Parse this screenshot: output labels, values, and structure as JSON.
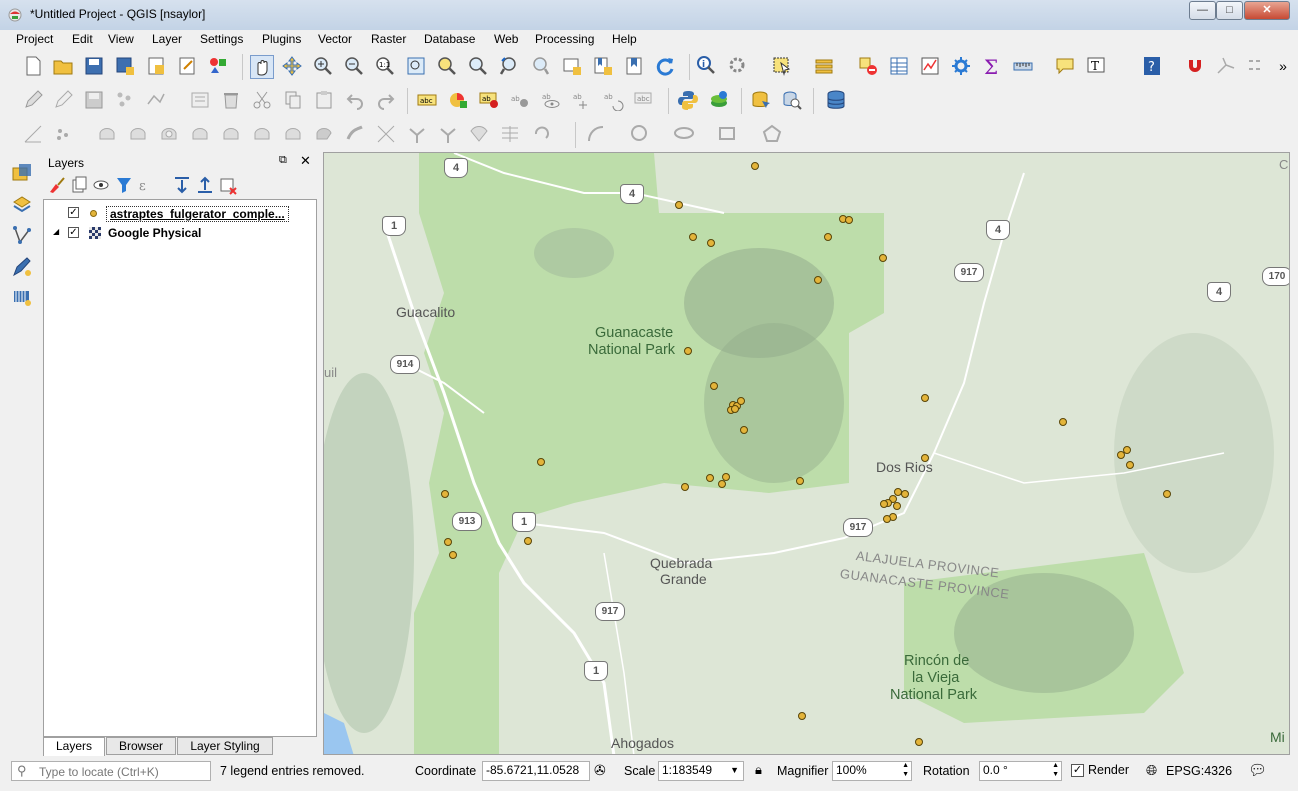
{
  "window": {
    "title": "*Untitled Project - QGIS [nsaylor]",
    "minimize": "—",
    "maximize": "□",
    "close": "✕"
  },
  "menu": [
    "Project",
    "Edit",
    "View",
    "Layer",
    "Settings",
    "Plugins",
    "Vector",
    "Raster",
    "Database",
    "Web",
    "Processing",
    "Help"
  ],
  "layers_panel": {
    "title": "Layers",
    "layers": [
      {
        "name": "astraptes_fulgerator_comple...",
        "checked": true,
        "icon": "point-layer-icon"
      },
      {
        "name": "Google Physical",
        "checked": true,
        "icon": "raster-layer-icon"
      }
    ],
    "tabs": [
      "Layers",
      "Browser",
      "Layer Styling"
    ],
    "active_tab": "Layers"
  },
  "map": {
    "places": [
      {
        "text": "Guacalito"
      },
      {
        "text": "Guanacaste"
      },
      {
        "text": "National Park"
      },
      {
        "text": "Dos Rios"
      },
      {
        "text": "Quebrada"
      },
      {
        "text": "Grande"
      },
      {
        "text": "ALAJUELA PROVINCE"
      },
      {
        "text": "GUANACASTE PROVINCE"
      },
      {
        "text": "Rincón de"
      },
      {
        "text": "la Vieja"
      },
      {
        "text": "National Park"
      },
      {
        "text": "Ahogados"
      },
      {
        "text": "Mi"
      },
      {
        "text": "C"
      },
      {
        "text": "uil"
      }
    ],
    "roads": [
      "4",
      "4",
      "1",
      "4",
      "917",
      "170",
      "4",
      "914",
      "913",
      "1",
      "917",
      "917",
      "1"
    ],
    "colors": {
      "park": "#b5d9a0",
      "land": "#dde6d6",
      "point": "#e3b43a",
      "water": "#9ac6f0"
    }
  },
  "status": {
    "locate_placeholder": "Type to locate (Ctrl+K)",
    "message": "7 legend entries removed.",
    "coordinate_label": "Coordinate",
    "coordinate_value": "-85.6721,11.0528",
    "scale_label": "Scale",
    "scale_value": "1:183549",
    "magnifier_label": "Magnifier",
    "magnifier_value": "100%",
    "rotation_label": "Rotation",
    "rotation_value": "0.0 °",
    "render_label": "Render",
    "crs": "EPSG:4326"
  }
}
